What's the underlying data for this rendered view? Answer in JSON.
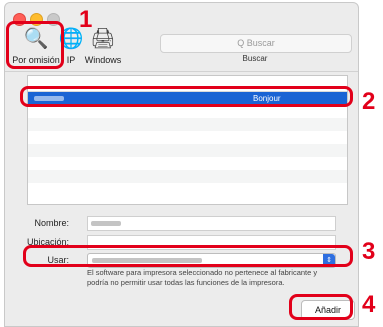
{
  "window": {
    "title": ""
  },
  "toolbar": {
    "default_label": "Por omisión",
    "ip_label": "IP",
    "windows_label": "Windows",
    "search_placeholder": "Q Buscar",
    "search_caption": "Buscar",
    "default_icon": "printer-magnifier-icon",
    "ip_icon": "globe-icon",
    "windows_icon": "printer-icon"
  },
  "printer_list": {
    "rows": [
      {
        "name": "",
        "kind": "Bonjour",
        "selected": true
      },
      {
        "name": "",
        "kind": "",
        "selected": false
      },
      {
        "name": "",
        "kind": "",
        "selected": false
      },
      {
        "name": "",
        "kind": "",
        "selected": false
      },
      {
        "name": "",
        "kind": "",
        "selected": false
      },
      {
        "name": "",
        "kind": "",
        "selected": false
      },
      {
        "name": "",
        "kind": "",
        "selected": false
      },
      {
        "name": "",
        "kind": "",
        "selected": false
      }
    ]
  },
  "form": {
    "name_label": "Nombre:",
    "location_label": "Ubicación:",
    "use_label": "Usar:",
    "warning_text": "El software para impresora seleccionado no pertenece al fabricante y podría no permitir usar todas las funciones de la impresora.",
    "add_button": "Añadir"
  },
  "callouts": {
    "step1": "1",
    "step2": "2",
    "step3": "3",
    "step4": "4"
  },
  "colors": {
    "accent": "#e2001a",
    "selection": "#1a64d4"
  }
}
